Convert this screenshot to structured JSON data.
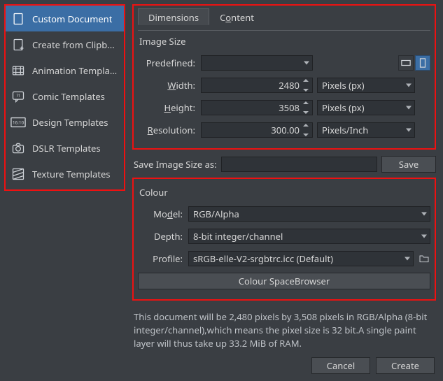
{
  "sidebar": {
    "items": [
      {
        "label": "Custom Document"
      },
      {
        "label": "Create from Clipb..."
      },
      {
        "label": "Animation Templat..."
      },
      {
        "label": "Comic Templates"
      },
      {
        "label": "Design Templates"
      },
      {
        "label": "DSLR Templates"
      },
      {
        "label": "Texture Templates"
      }
    ]
  },
  "tabs": {
    "dimensions": "Dimensions",
    "content_pre": "C",
    "content_ul": "o",
    "content_post": "ntent"
  },
  "img": {
    "title": "Image Size",
    "predefined_label": "Predefined:",
    "width_pre": "",
    "width_ul": "W",
    "width_post": "idth:",
    "height_pre": "",
    "height_ul": "H",
    "height_post": "eight:",
    "resolution_pre": "",
    "resolution_ul": "R",
    "resolution_post": "esolution:",
    "width": "2480",
    "height": "3508",
    "resolution": "300.00",
    "unit_w": "Pixels (px)",
    "unit_h": "Pixels (px)",
    "unit_r": "Pixels/Inch"
  },
  "save": {
    "label": "Save Image Size as:",
    "value": "",
    "btn": "Save"
  },
  "colour": {
    "title": "Colour",
    "model_pre": "Mo",
    "model_ul": "d",
    "model_post": "el:",
    "depth_label": "Depth:",
    "profile_label": "Profile:",
    "model": "RGB/Alpha",
    "depth": "8-bit integer/channel",
    "profile": "sRGB-elle-V2-srgbtrc.icc (Default)",
    "browser_pre": "Colour Space ",
    "browser_ul": "B",
    "browser_post": "rowser"
  },
  "footer": {
    "text": "This document will be 2,480 pixels by 3,508 pixels in RGB/Alpha (8-bit integer/channel),which means the pixel size is 32 bit.A single paint layer will thus take up 33.2 MiB of RAM.",
    "cancel": "Cancel",
    "create_ul": "C",
    "create_post": "reate"
  }
}
